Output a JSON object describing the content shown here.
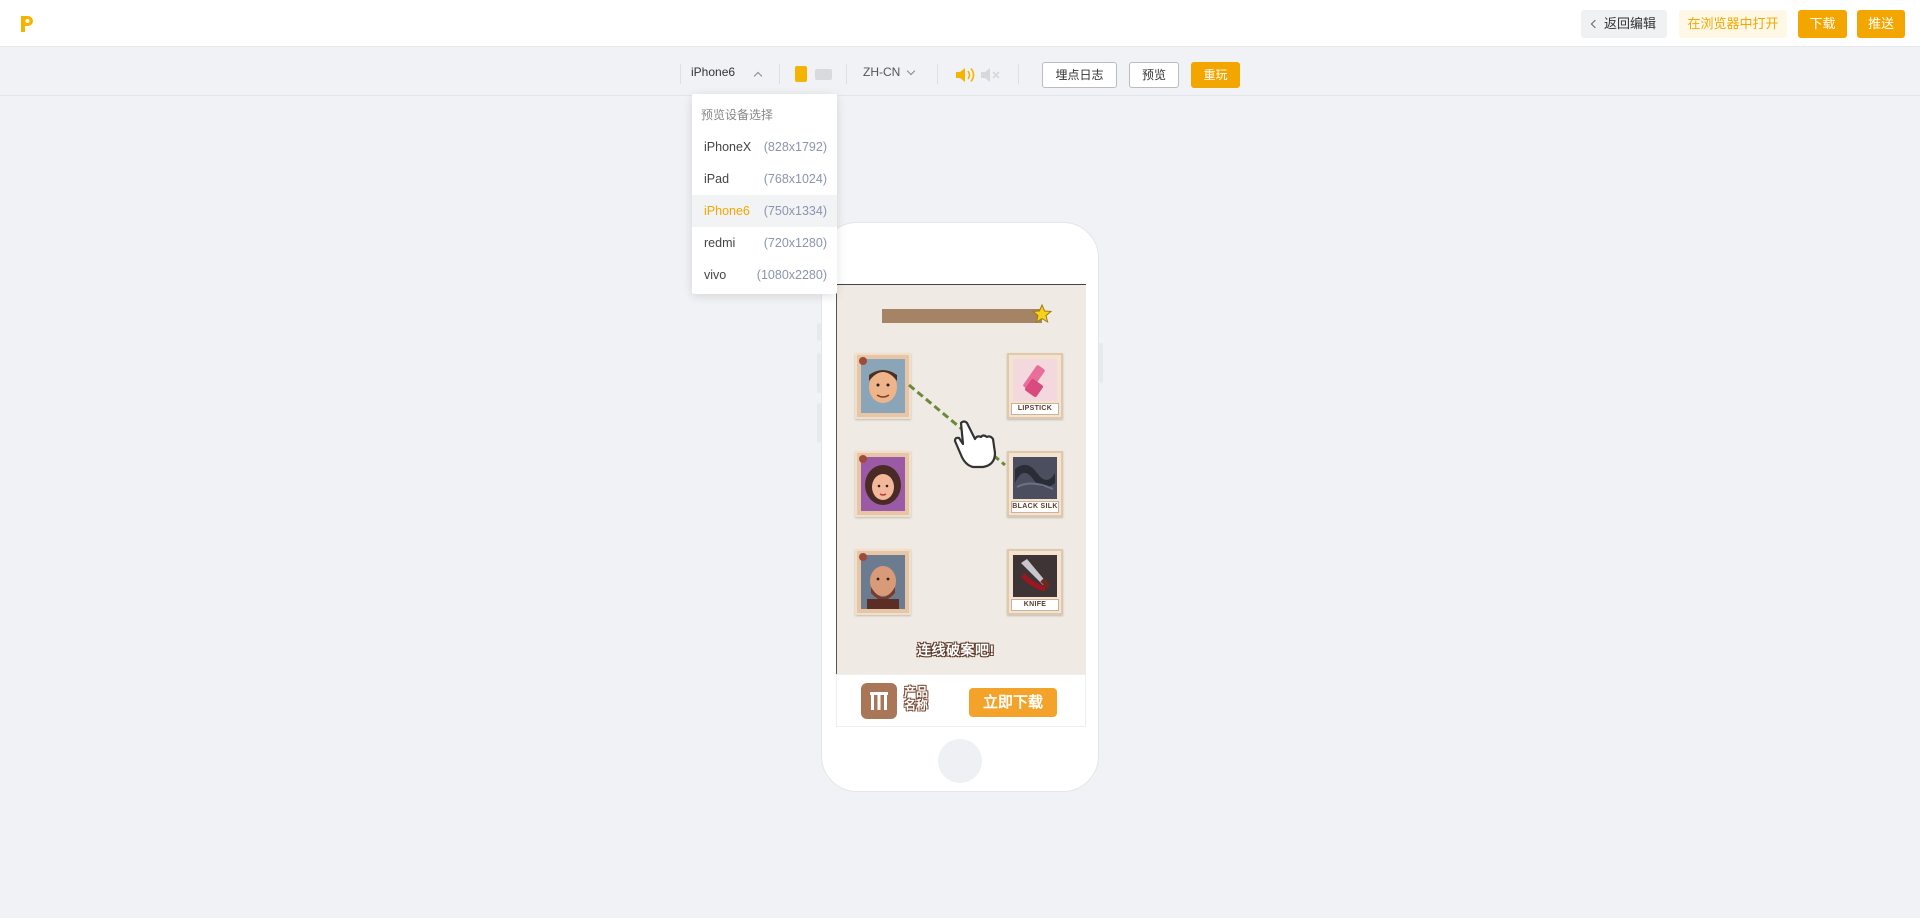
{
  "header": {
    "logo_icon": "p-logo-icon",
    "back_label": "返回编辑",
    "open_browser_label": "在浏览器中打开",
    "download_label": "下载",
    "push_label": "推送",
    "accent_color": "#f4a600"
  },
  "toolbar": {
    "device_selected": "iPhone6",
    "language_selected": "ZH-CN",
    "event_log_label": "埋点日志",
    "preview_label": "预览",
    "replay_label": "重玩"
  },
  "device_dropdown": {
    "title": "预览设备选择",
    "items": [
      {
        "name": "iPhoneX",
        "resolution": "(828x1792)",
        "selected": false
      },
      {
        "name": "iPad",
        "resolution": "(768x1024)",
        "selected": false
      },
      {
        "name": "iPhone6",
        "resolution": "(750x1334)",
        "selected": true
      },
      {
        "name": "redmi",
        "resolution": "(720x1280)",
        "selected": false
      },
      {
        "name": "vivo",
        "resolution": "(1080x2280)",
        "selected": false
      }
    ]
  },
  "game": {
    "items": [
      {
        "label": "LIPSTICK"
      },
      {
        "label": "BLACK SILK"
      },
      {
        "label": "KNIFE"
      }
    ],
    "cta_text": "连线破案吧!"
  },
  "banner": {
    "app_name": "产品名称",
    "download_text": "立即下载"
  }
}
